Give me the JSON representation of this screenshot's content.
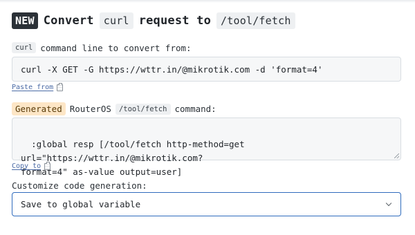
{
  "header": {
    "badge": "NEW",
    "prefix": "Convert",
    "chip_curl": "curl",
    "middle": "request to",
    "chip_path": "/tool/fetch"
  },
  "input_section": {
    "chip": "curl",
    "label": "command line to convert from:",
    "value": "curl -X GET -G https://wttr.in/@mikrotik.com -d 'format=4'",
    "paste_label": "Paste from"
  },
  "output_section": {
    "generated_chip": "Generated",
    "label_mid": "RouterOS",
    "chip": "/tool/fetch",
    "label_end": "command:",
    "value": ":global resp [/tool/fetch http-method=get url=\"https://wttr.in/@mikrotik.com?\nformat=4\" as-value output=user]",
    "copy_label": "Copy to"
  },
  "customize": {
    "label": "Customize code generation:",
    "selected": "Save to global variable"
  },
  "icons": {
    "clipboard": "clipboard-icon",
    "chevron": "chevron-down-icon"
  },
  "colors": {
    "badge_bg": "#2b3137",
    "generated_chip_bg": "#fde6c6",
    "link": "#4a6aa5",
    "select_border": "#2f6bbd"
  }
}
